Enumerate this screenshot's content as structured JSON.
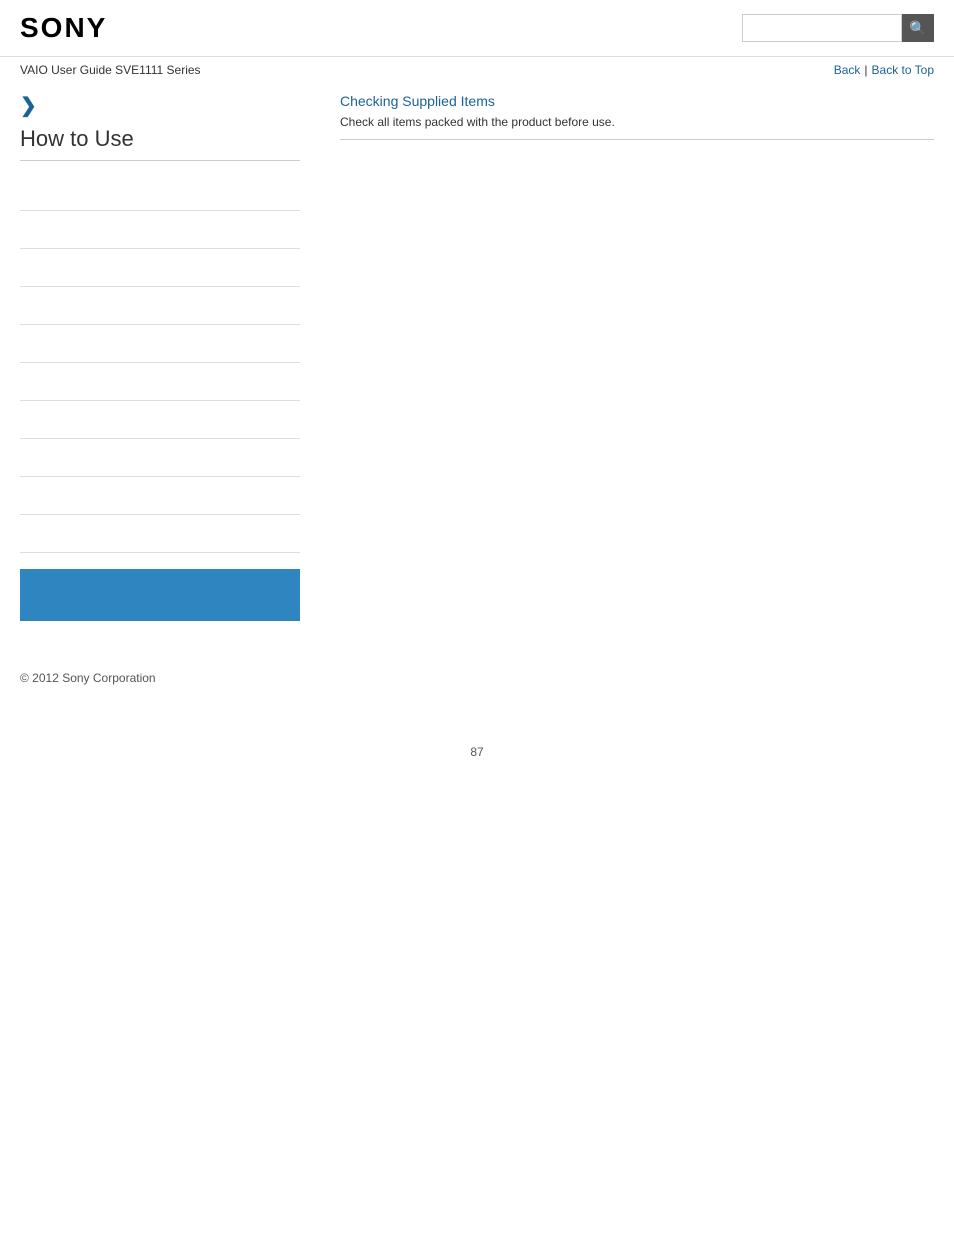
{
  "header": {
    "logo": "SONY",
    "search_placeholder": "",
    "search_icon": "🔍"
  },
  "nav": {
    "guide_title": "VAIO User Guide SVE1111 Series",
    "back_label": "Back",
    "separator": "|",
    "back_to_top_label": "Back to Top"
  },
  "sidebar": {
    "chevron": "❯",
    "title": "How to Use",
    "menu_items": [
      {
        "label": ""
      },
      {
        "label": ""
      },
      {
        "label": ""
      },
      {
        "label": ""
      },
      {
        "label": ""
      },
      {
        "label": ""
      },
      {
        "label": ""
      },
      {
        "label": ""
      },
      {
        "label": ""
      },
      {
        "label": ""
      }
    ],
    "blue_box_color": "#2e85c0"
  },
  "content": {
    "link_text": "Checking Supplied Items",
    "description": "Check all items packed with the product before use."
  },
  "footer": {
    "copyright": "© 2012 Sony Corporation"
  },
  "page_number": "87"
}
